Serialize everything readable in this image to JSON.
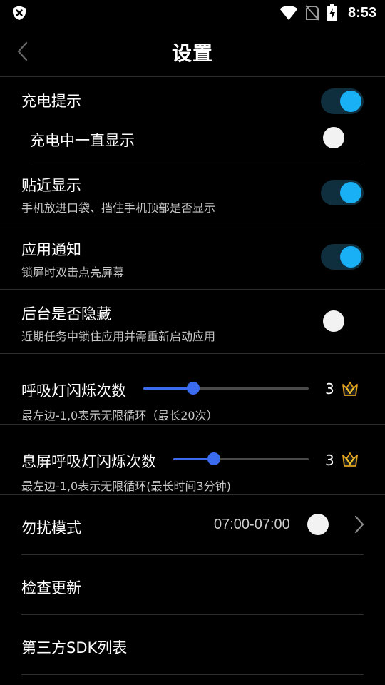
{
  "status_bar": {
    "time": "8:53"
  },
  "header": {
    "title": "设置"
  },
  "settings": {
    "charging_tip": {
      "label": "充电提示",
      "enabled": true
    },
    "charging_always": {
      "label": "充电中一直显示",
      "enabled": false
    },
    "proximity": {
      "label": "贴近显示",
      "description": "手机放进口袋、挡住手机顶部是否显示",
      "enabled": true
    },
    "app_notify": {
      "label": "应用通知",
      "description": "锁屏时双击点亮屏幕",
      "enabled": true
    },
    "hide_background": {
      "label": "后台是否隐藏",
      "description": "近期任务中锁住应用并需重新启动应用",
      "enabled": false
    },
    "breath_count": {
      "label": "呼吸灯闪烁次数",
      "description": "最左边-1,0表示无限循环（最长20次）",
      "value": "3",
      "fraction": 0.3
    },
    "screen_off_breath_count": {
      "label": "息屏呼吸灯闪烁次数",
      "description": "最左边-1,0表示无限循环(最长时间3分钟)",
      "value": "3",
      "fraction": 0.3
    },
    "dnd": {
      "label": "勿扰模式",
      "time_range": "07:00-07:00",
      "enabled": false
    },
    "check_update": {
      "label": "检查更新"
    },
    "sdk_list": {
      "label": "第三方SDK列表"
    }
  },
  "colors": {
    "accent_toggle": "#1ab0f5",
    "accent_slider": "#3b6cf0",
    "background": "#000000"
  },
  "icons": {
    "status_left": "shield-x-icon",
    "wifi": "wifi-icon",
    "sim": "no-sim-icon",
    "battery": "battery-charging-icon",
    "back": "chevron-left-icon",
    "crown": "crown-icon",
    "arrow": "chevron-right-icon"
  }
}
